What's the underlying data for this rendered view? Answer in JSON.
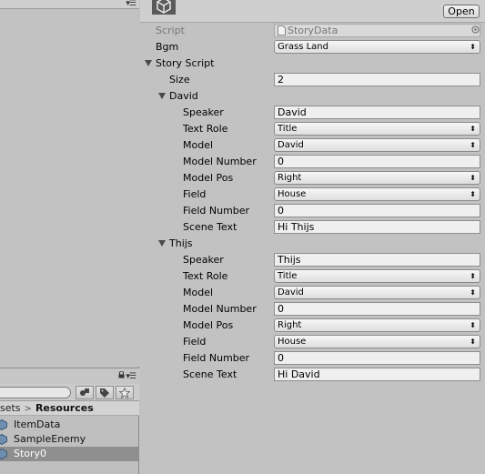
{
  "project": {
    "breadcrumb": {
      "prev": "sets",
      "current": "Resources"
    },
    "assets": [
      {
        "label": "ItemData",
        "selected": false
      },
      {
        "label": "SampleEnemy",
        "selected": false
      },
      {
        "label": "Story0",
        "selected": true
      }
    ]
  },
  "inspector": {
    "open_label": "Open",
    "script": {
      "label": "Script",
      "value": "StoryData"
    },
    "bgm": {
      "label": "Bgm",
      "value": "Grass Land"
    },
    "story_script": {
      "label": "Story Script",
      "size_label": "Size",
      "size_value": "2",
      "elements": [
        {
          "name": "David",
          "speaker_label": "Speaker",
          "speaker": "David",
          "text_role_label": "Text Role",
          "text_role": "Title",
          "model_label": "Model",
          "model": "David",
          "model_number_label": "Model Number",
          "model_number": "0",
          "model_pos_label": "Model Pos",
          "model_pos": "Right",
          "field_label": "Field",
          "field": "House",
          "field_number_label": "Field Number",
          "field_number": "0",
          "scene_text_label": "Scene Text",
          "scene_text": "Hi Thijs"
        },
        {
          "name": "Thijs",
          "speaker_label": "Speaker",
          "speaker": "Thijs",
          "text_role_label": "Text Role",
          "text_role": "Title",
          "model_label": "Model",
          "model": "David",
          "model_number_label": "Model Number",
          "model_number": "0",
          "model_pos_label": "Model Pos",
          "model_pos": "Right",
          "field_label": "Field",
          "field": "House",
          "field_number_label": "Field Number",
          "field_number": "0",
          "scene_text_label": "Scene Text",
          "scene_text": "Hi David"
        }
      ]
    }
  },
  "icons": {
    "dropdown_arrow": "⬍",
    "menu": "▾☰"
  },
  "colors": {
    "panel_bg": "#c2c2c2",
    "selected_row": "#8f8f8f",
    "field_bg": "#efefef"
  }
}
